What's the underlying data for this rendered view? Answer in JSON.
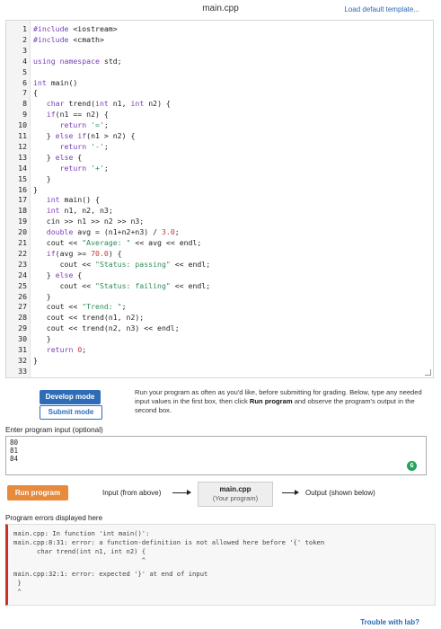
{
  "header": {
    "file_name": "main.cpp",
    "load_template_link": "Load default template..."
  },
  "code_lines": [
    {
      "n": "1",
      "t": "#include <iostream>"
    },
    {
      "n": "2",
      "t": "#include <cmath>"
    },
    {
      "n": "3",
      "t": ""
    },
    {
      "n": "4",
      "t": "using namespace std;"
    },
    {
      "n": "5",
      "t": ""
    },
    {
      "n": "6",
      "t": "int main()"
    },
    {
      "n": "7",
      "t": "{"
    },
    {
      "n": "8",
      "t": "   char trend(int n1, int n2) {"
    },
    {
      "n": "9",
      "t": "   if(n1 == n2) {"
    },
    {
      "n": "10",
      "t": "      return '=';"
    },
    {
      "n": "11",
      "t": "   } else if(n1 > n2) {"
    },
    {
      "n": "12",
      "t": "      return '-';"
    },
    {
      "n": "13",
      "t": "   } else {"
    },
    {
      "n": "14",
      "t": "      return '+';"
    },
    {
      "n": "15",
      "t": "   }"
    },
    {
      "n": "16",
      "t": "}"
    },
    {
      "n": "17",
      "t": "   int main() {"
    },
    {
      "n": "18",
      "t": "   int n1, n2, n3;"
    },
    {
      "n": "19",
      "t": "   cin >> n1 >> n2 >> n3;"
    },
    {
      "n": "20",
      "t": "   double avg = (n1+n2+n3) / 3.0;"
    },
    {
      "n": "21",
      "t": "   cout << \"Average: \" << avg << endl;"
    },
    {
      "n": "22",
      "t": "   if(avg >= 70.0) {"
    },
    {
      "n": "23",
      "t": "      cout << \"Status: passing\" << endl;"
    },
    {
      "n": "24",
      "t": "   } else {"
    },
    {
      "n": "25",
      "t": "      cout << \"Status: failing\" << endl;"
    },
    {
      "n": "26",
      "t": "   }"
    },
    {
      "n": "27",
      "t": "   cout << \"Trend: \";"
    },
    {
      "n": "28",
      "t": "   cout << trend(n1, n2);"
    },
    {
      "n": "29",
      "t": "   cout << trend(n2, n3) << endl;"
    },
    {
      "n": "30",
      "t": "   }"
    },
    {
      "n": "31",
      "t": "   return 0;"
    },
    {
      "n": "32",
      "t": "}"
    },
    {
      "n": "33",
      "t": ""
    }
  ],
  "modes": {
    "develop_label": "Develop mode",
    "submit_label": "Submit mode"
  },
  "instructions": {
    "part1": "Run your program as often as you'd like, before submitting for grading. Below, type any needed input values in the first box, then click ",
    "bold1": "Run program",
    "part2": " and observe the program's output in the second box."
  },
  "input": {
    "label": "Enter program input (optional)",
    "values": [
      "80",
      "81",
      "84"
    ],
    "badge": "G"
  },
  "run": {
    "button_label": "Run program",
    "input_caption": "Input (from above)",
    "main_box_title": "main.cpp",
    "main_box_sub": "(Your program)",
    "output_caption": "Output (shown below)"
  },
  "errors": {
    "label": "Program errors displayed here",
    "lines": [
      "main.cpp: In function 'int main()':",
      "main.cpp:8:31: error: a function-definition is not allowed here before '{' token",
      "      char trend(int n1, int n2) {",
      "                                 ^",
      "main.cpp:32:1: error: expected '}' at end of input",
      " }",
      " ^"
    ]
  },
  "footer": {
    "trouble_link": "Trouble with lab?"
  },
  "colors": {
    "accent_blue": "#2e6cb8",
    "run_orange": "#e88a3c",
    "error_red": "#c9302c",
    "badge_green": "#22a35a"
  }
}
